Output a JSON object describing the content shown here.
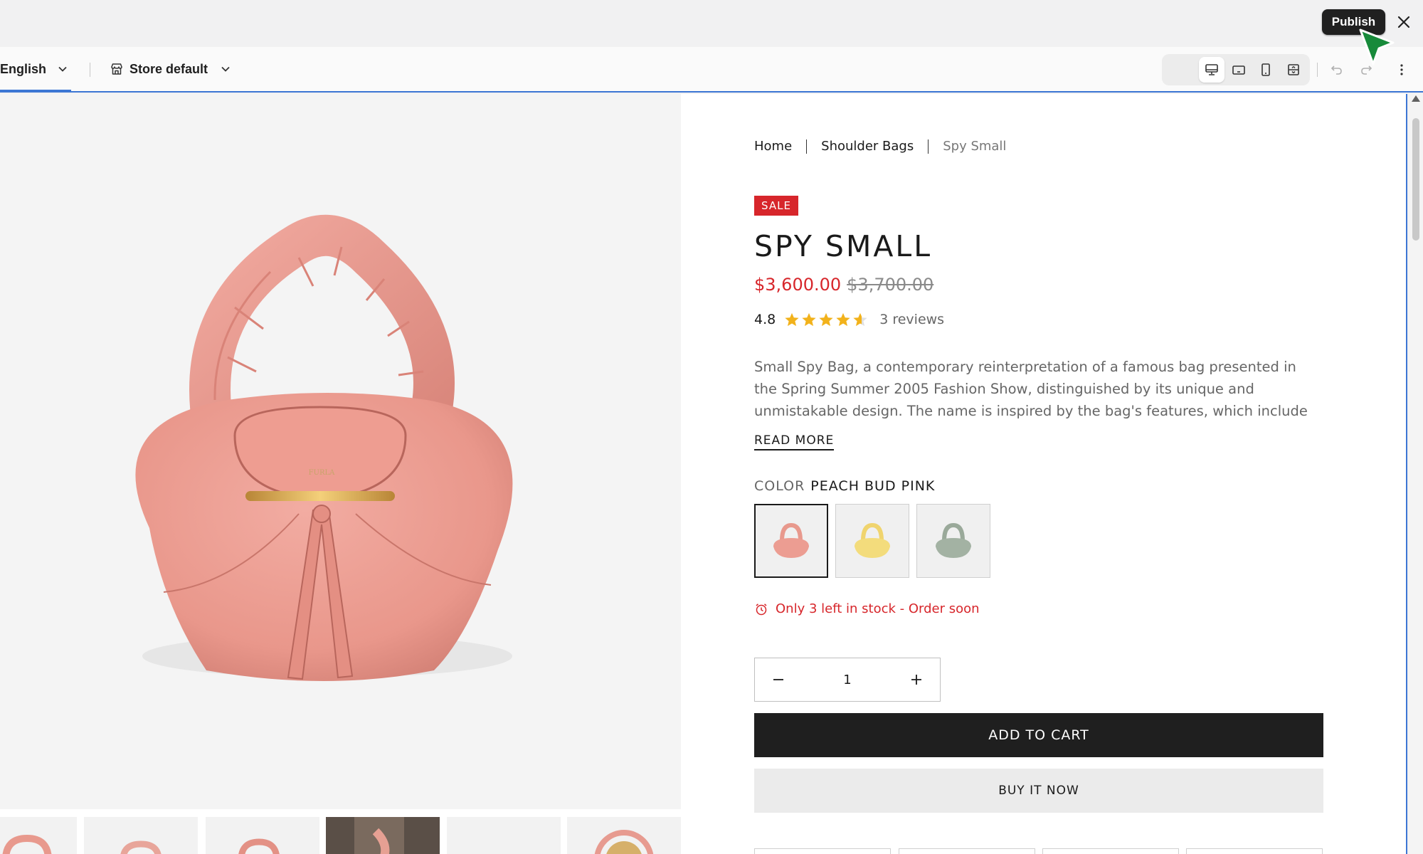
{
  "editor": {
    "publish_label": "Publish",
    "language": "English",
    "store": "Store default"
  },
  "product": {
    "breadcrumbs": [
      "Home",
      "Shoulder Bags",
      "Spy Small"
    ],
    "badge": "SALE",
    "title": "SPY SMALL",
    "price": "$3,600.00",
    "compare_price": "$3,700.00",
    "rating": "4.8",
    "stars": 4.8,
    "reviews": "3 reviews",
    "description": "Small Spy Bag, a contemporary reinterpretation of a famous bag presented in the Spring Summer 2005 Fashion Show, distinguished by its unique and unmistakable design. The name is inspired by the bag's features, which include a secret pocket",
    "read_more": "READ MORE",
    "color_label": "COLOR",
    "color_value": "PEACH BUD PINK",
    "swatches": [
      "peach bud pink",
      "yellow",
      "sage green"
    ],
    "stock_message": "Only 3 left in stock - Order soon",
    "quantity": "1",
    "add_to_cart": "ADD TO CART",
    "buy_now": "BUY IT NOW"
  },
  "colors": {
    "accent": "#3c76d4",
    "sale_red": "#d7262b",
    "bag_pink": "#ec9d92"
  }
}
